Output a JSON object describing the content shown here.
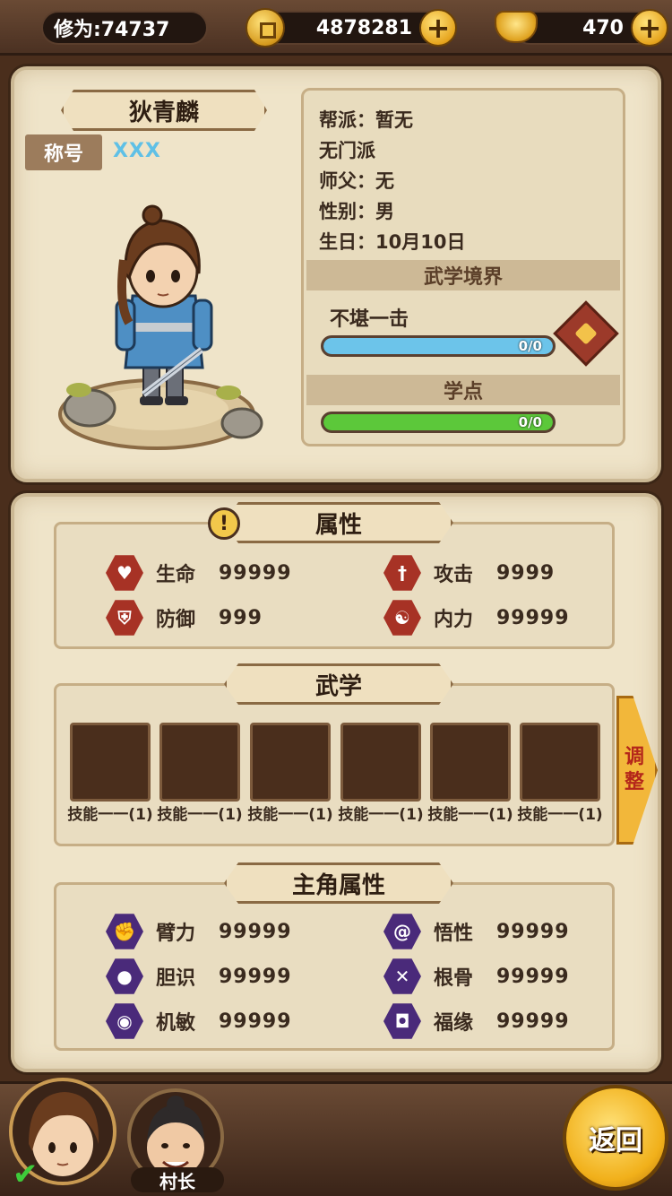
{
  "topbar": {
    "cultivation": "修为:74737",
    "coins": "4878281",
    "ingots": "470",
    "plus_icon": "+"
  },
  "character": {
    "name": "狄青麟",
    "title_label": "称号",
    "title_value": "XXX",
    "faction": "帮派：暂无",
    "school": "无门派",
    "master": "师父：无",
    "gender": "性别：男",
    "birthday": "生日：10月10日"
  },
  "realm": {
    "header": "武学境界",
    "level": "不堪一击",
    "progress_text": "0/0",
    "progress": 0
  },
  "study_points": {
    "header": "学点",
    "progress_text": "0/0",
    "progress": 0
  },
  "attributes": {
    "header": "属性",
    "alert_icon": "!",
    "items": [
      {
        "label": "生命",
        "value": "99999"
      },
      {
        "label": "攻击",
        "value": "9999"
      },
      {
        "label": "防御",
        "value": "999"
      },
      {
        "label": "内力",
        "value": "99999"
      }
    ]
  },
  "martial": {
    "header": "武学",
    "adjust_label_1": "调",
    "adjust_label_2": "整",
    "skills": [
      "技能一一(1)",
      "技能一一(1)",
      "技能一一(1)",
      "技能一一(1)",
      "技能一一(1)",
      "技能一一(1)"
    ]
  },
  "hero_attributes": {
    "header": "主角属性",
    "items": [
      {
        "label": "臂力",
        "value": "99999"
      },
      {
        "label": "悟性",
        "value": "99999"
      },
      {
        "label": "胆识",
        "value": "99999"
      },
      {
        "label": "根骨",
        "value": "99999"
      },
      {
        "label": "机敏",
        "value": "99999"
      },
      {
        "label": "福缘",
        "value": "99999"
      }
    ]
  },
  "bottombar": {
    "chief_label": "村长",
    "check_icon": "✔",
    "back_label": "返回"
  },
  "colors": {
    "accent_gold": "#f1b01a",
    "panel_bg": "#efe4c9",
    "realm_bar": "#6cc4ea",
    "study_bar": "#5cc83a",
    "attr_icon_red": "#a73225",
    "hero_icon_purple": "#4a2a7a"
  }
}
